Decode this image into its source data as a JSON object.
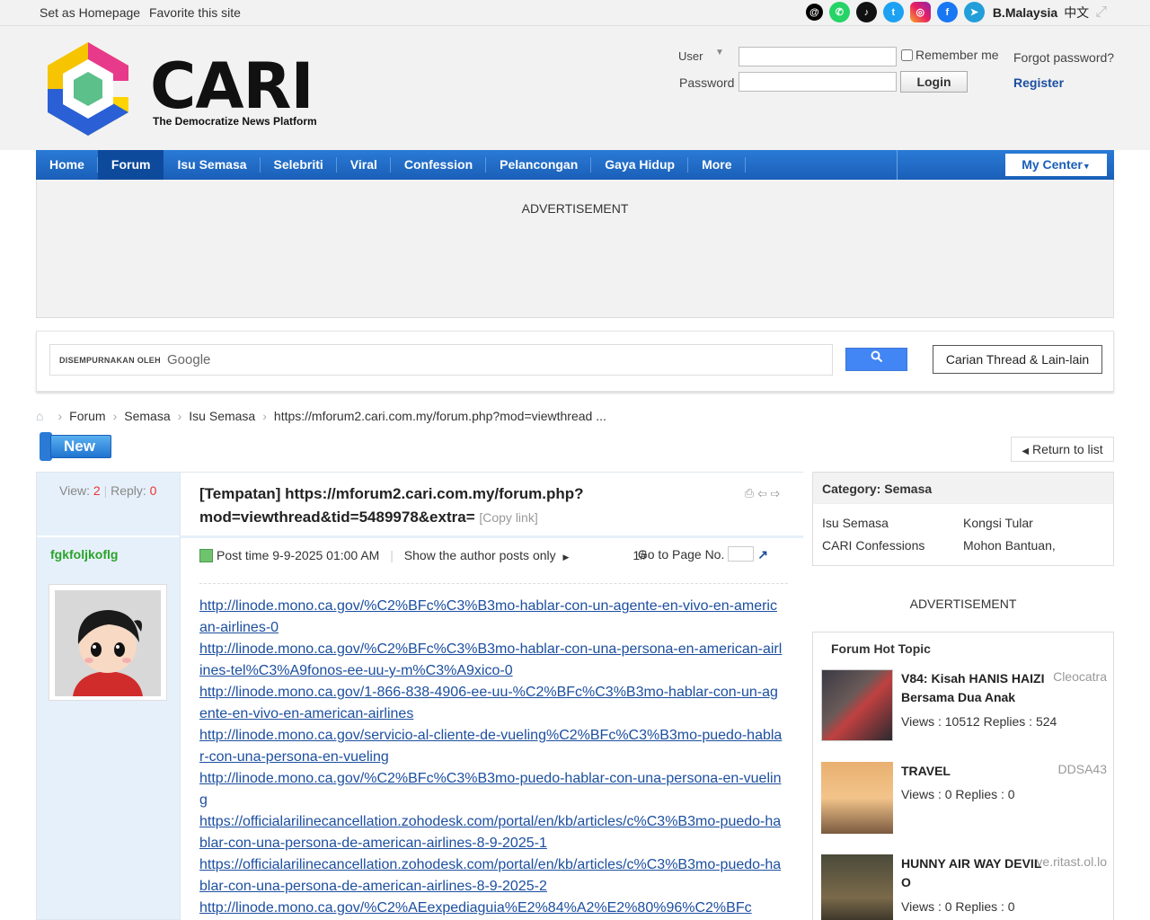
{
  "topbar": {
    "set_homepage": "Set as Homepage",
    "favorite": "Favorite this site",
    "region": "B.Malaysia",
    "lang": "中文"
  },
  "brand": {
    "name": "CARI",
    "tagline": "The Democratize News Platform"
  },
  "login": {
    "user_label": "User",
    "password_label": "Password",
    "remember_label": "Remember me",
    "forgot_label": "Forgot password?",
    "login_button": "Login",
    "register_label": "Register"
  },
  "nav": {
    "items": [
      "Home",
      "Forum",
      "Isu Semasa",
      "Selebriti",
      "Viral",
      "Confession",
      "Pelancongan",
      "Gaya Hidup",
      "More"
    ],
    "my_center": "My Center"
  },
  "ad": {
    "label": "ADVERTISEMENT"
  },
  "search": {
    "powered_by": "DISEMPURNAKAN OLEH",
    "google": "Google",
    "thread_search": "Carian Thread & Lain-lain"
  },
  "breadcrumb": [
    "Forum",
    "Semasa",
    "Isu Semasa",
    "https://mforum2.cari.com.my/forum.php?mod=viewthread ..."
  ],
  "new_button": "New",
  "return_button": "Return to list",
  "thread": {
    "view_label": "View:",
    "views": "2",
    "reply_label": "Reply:",
    "replies": "0",
    "author": "fgkfoljkoflg",
    "title": "[Tempatan] https://mforum2.cari.com.my/forum.php?mod=viewthread&tid=5489978&extra=",
    "copy_link": "[Copy link]",
    "post_time": "Post time 9-9-2025 01:00 AM",
    "author_only": "Show the author posts only",
    "floor": "1#",
    "goto_page": "Go to Page No.",
    "links": [
      "http://linode.mono.ca.gov/%C2%BFc%C3%B3mo-hablar-con-un-agente-en-vivo-en-american-airlines-0",
      "http://linode.mono.ca.gov/%C2%BFc%C3%B3mo-hablar-con-una-persona-en-american-airlines-tel%C3%A9fonos-ee-uu-y-m%C3%A9xico-0",
      "http://linode.mono.ca.gov/1-866-838-4906-ee-uu-%C2%BFc%C3%B3mo-hablar-con-un-agente-en-vivo-en-american-airlines",
      "http://linode.mono.ca.gov/servicio-al-cliente-de-vueling%C2%BFc%C3%B3mo-puedo-hablar-con-una-persona-en-vueling",
      "http://linode.mono.ca.gov/%C2%BFc%C3%B3mo-puedo-hablar-con-una-persona-en-vueling",
      "https://officialarilinecancellation.zohodesk.com/portal/en/kb/articles/c%C3%B3mo-puedo-hablar-con-una-persona-de-american-airlines-8-9-2025-1",
      "https://officialarilinecancellation.zohodesk.com/portal/en/kb/articles/c%C3%B3mo-puedo-hablar-con-una-persona-de-american-airlines-8-9-2025-2",
      "http://linode.mono.ca.gov/%C2%AEexpediaguia%E2%84%A2%E2%80%96%C2%BFc"
    ]
  },
  "category": {
    "header": "Category: Semasa",
    "items": [
      "Isu Semasa",
      "Kongsi Tular",
      "CARI Confessions",
      "Mohon Bantuan,"
    ]
  },
  "hot": {
    "header": "Forum Hot Topic",
    "items": [
      {
        "title": "V84: Kisah HANIS HAIZI Bersama Dua Anak",
        "author": "Cleocatra",
        "stats": "Views : 10512 Replies : 524"
      },
      {
        "title": "TRAVEL",
        "author": "DDSA43",
        "stats": "Views : 0 Replies : 0"
      },
      {
        "title": "HUNNY AIR WAY DEVIL O",
        "author": "ve.ritast.ol.lo",
        "stats": "Views : 0 Replies : 0"
      }
    ]
  },
  "colors": {
    "nav": "#1a5fb8",
    "author": "#29a329",
    "link": "#1c4fa0"
  }
}
